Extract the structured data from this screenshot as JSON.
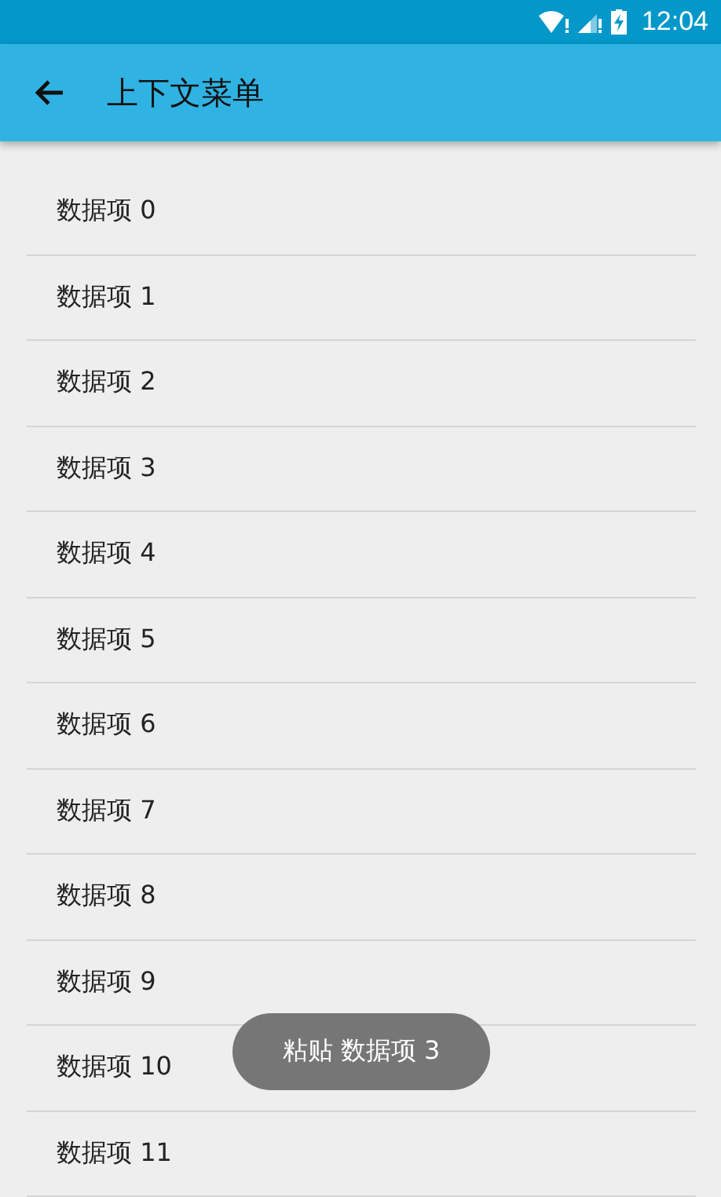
{
  "status_bar": {
    "time": "12:04"
  },
  "app_bar": {
    "title": "上下文菜单"
  },
  "list": {
    "items": [
      {
        "label": "数据项 0"
      },
      {
        "label": "数据项 1"
      },
      {
        "label": "数据项 2"
      },
      {
        "label": "数据项 3"
      },
      {
        "label": "数据项 4"
      },
      {
        "label": "数据项 5"
      },
      {
        "label": "数据项 6"
      },
      {
        "label": "数据项 7"
      },
      {
        "label": "数据项 8"
      },
      {
        "label": "数据项 9"
      },
      {
        "label": "数据项 10"
      },
      {
        "label": "数据项 11"
      }
    ]
  },
  "toast": {
    "text": "粘贴 数据项 3"
  }
}
